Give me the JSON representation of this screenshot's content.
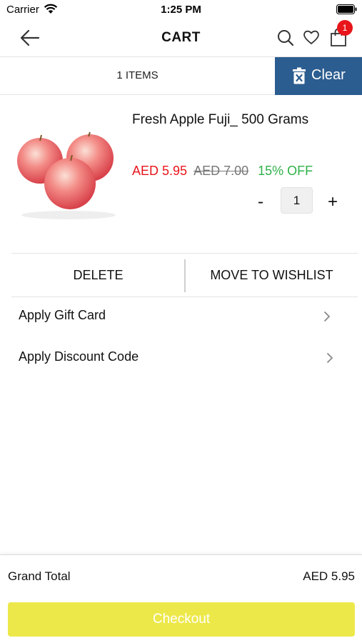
{
  "status_bar": {
    "carrier": "Carrier",
    "time": "1:25 PM"
  },
  "nav": {
    "title": "CART",
    "cart_badge": "1"
  },
  "cart_header": {
    "items_count": "1 ITEMS",
    "clear_label": "Clear"
  },
  "product": {
    "name": "Fresh Apple Fuji_ 500 Grams",
    "price": "AED 5.95",
    "old_price": "AED 7.00",
    "discount": "15% OFF",
    "qty_minus": "-",
    "quantity": "1",
    "qty_plus": "+"
  },
  "actions": {
    "delete_label": "DELETE",
    "wishlist_label": "MOVE TO WISHLIST"
  },
  "options": [
    {
      "label": "Apply Gift Card"
    },
    {
      "label": "Apply Discount Code"
    }
  ],
  "footer": {
    "total_label": "Grand Total",
    "total_value": "AED 5.95",
    "checkout_label": "Checkout"
  },
  "colors": {
    "accent_blue": "#2c5d90",
    "price_red": "#e8151b",
    "discount_green": "#2fb14a",
    "checkout_yellow": "#ede84a",
    "badge_red": "#e8151b"
  },
  "icons": [
    "wifi-icon",
    "battery-icon",
    "back-arrow-icon",
    "search-icon",
    "heart-icon",
    "shopping-bag-icon",
    "trash-icon",
    "chevron-right-icon"
  ]
}
